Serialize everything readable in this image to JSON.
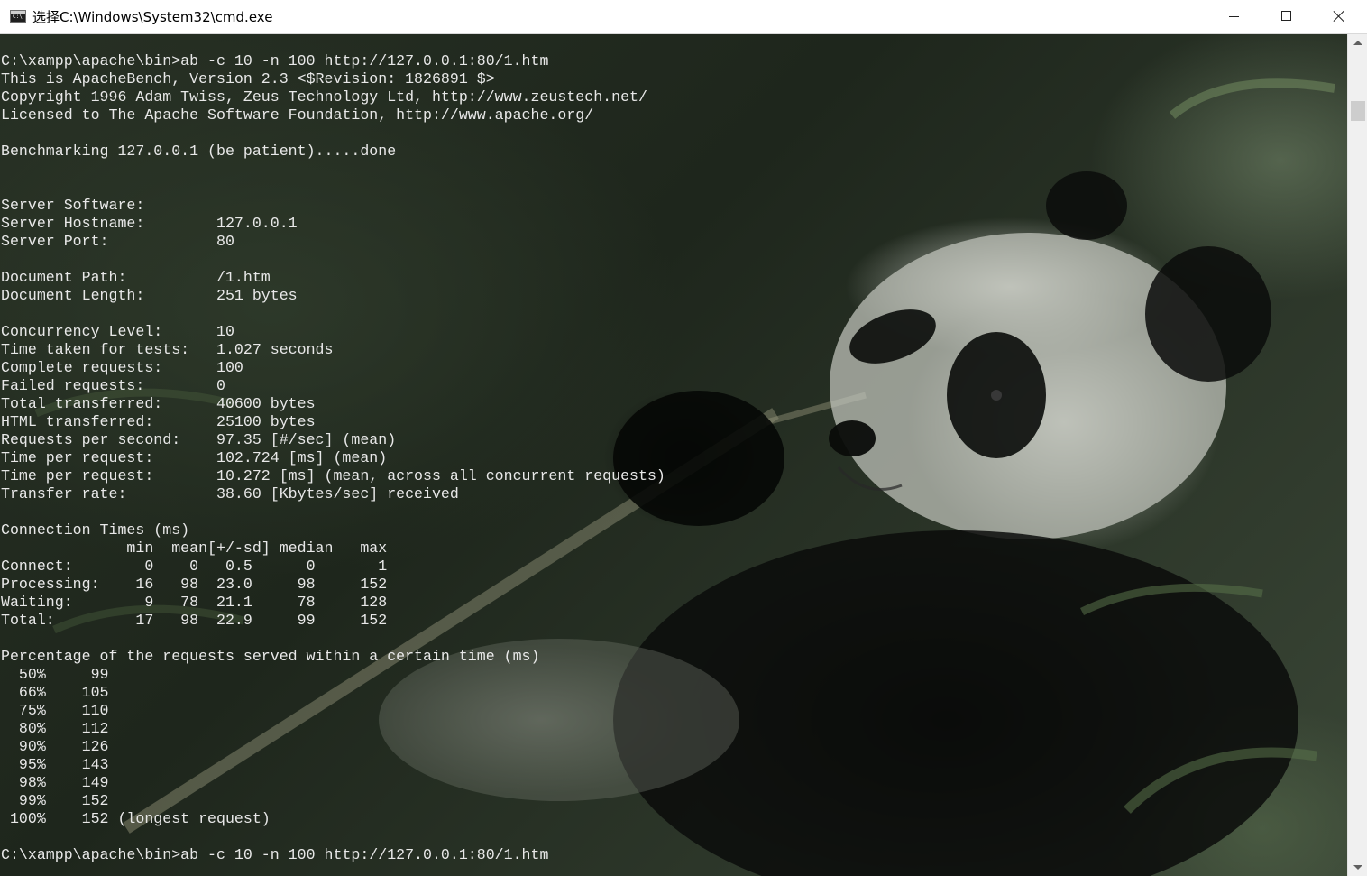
{
  "window": {
    "title": "选择C:\\Windows\\System32\\cmd.exe",
    "app_icon": "cmd-icon",
    "controls": {
      "minimize_icon": "minimize-icon",
      "maximize_icon": "maximize-icon",
      "close_icon": "close-icon"
    }
  },
  "background": {
    "image": "giant-panda-eating-bamboo",
    "dominant_colors": [
      "#2a3427",
      "#c9ccc4",
      "#0b0d0b"
    ]
  },
  "terminal": {
    "text_color": "#e8e8e8",
    "lines": [
      "C:\\xampp\\apache\\bin>ab -c 10 -n 100 http://127.0.0.1:80/1.htm",
      "This is ApacheBench, Version 2.3 <$Revision: 1826891 $>",
      "Copyright 1996 Adam Twiss, Zeus Technology Ltd, http://www.zeustech.net/",
      "Licensed to The Apache Software Foundation, http://www.apache.org/",
      "",
      "Benchmarking 127.0.0.1 (be patient).....done",
      "",
      "",
      "Server Software:",
      "Server Hostname:        127.0.0.1",
      "Server Port:            80",
      "",
      "Document Path:          /1.htm",
      "Document Length:        251 bytes",
      "",
      "Concurrency Level:      10",
      "Time taken for tests:   1.027 seconds",
      "Complete requests:      100",
      "Failed requests:        0",
      "Total transferred:      40600 bytes",
      "HTML transferred:       25100 bytes",
      "Requests per second:    97.35 [#/sec] (mean)",
      "Time per request:       102.724 [ms] (mean)",
      "Time per request:       10.272 [ms] (mean, across all concurrent requests)",
      "Transfer rate:          38.60 [Kbytes/sec] received",
      "",
      "Connection Times (ms)",
      "              min  mean[+/-sd] median   max",
      "Connect:        0    0   0.5      0       1",
      "Processing:    16   98  23.0     98     152",
      "Waiting:        9   78  21.1     78     128",
      "Total:         17   98  22.9     99     152",
      "",
      "Percentage of the requests served within a certain time (ms)",
      "  50%     99",
      "  66%    105",
      "  75%    110",
      "  80%    112",
      "  90%    126",
      "  95%    143",
      "  98%    149",
      "  99%    152",
      " 100%    152 (longest request)",
      "",
      "C:\\xampp\\apache\\bin>ab -c 10 -n 100 http://127.0.0.1:80/1.htm"
    ]
  },
  "scrollbar": {
    "up_icon": "scroll-up-arrow-icon",
    "down_icon": "scroll-down-arrow-icon",
    "position_fraction": 0.06
  }
}
